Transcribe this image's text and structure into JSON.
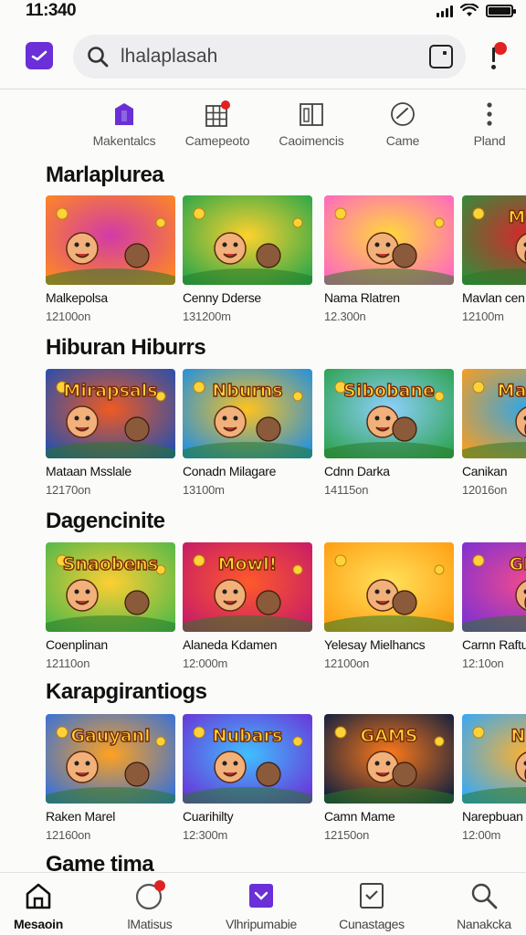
{
  "status": {
    "time": "11:340"
  },
  "header": {
    "search_value": "lhalaplasah"
  },
  "categories": [
    {
      "label": "Makentalcs",
      "icon": "house-icon"
    },
    {
      "label": "Camepeoto",
      "icon": "grid-icon"
    },
    {
      "label": "Caoimencis",
      "icon": "panel-icon"
    },
    {
      "label": "Came",
      "icon": "check-circle-icon"
    },
    {
      "label": "Pland",
      "icon": "more-vertical-icon"
    }
  ],
  "sections": [
    {
      "title": "Marlaplurea",
      "cards": [
        {
          "title": "Malkepolsa",
          "meta": "12100on",
          "art": ""
        },
        {
          "title": "Cenny Dderse",
          "meta": "131200m",
          "art": ""
        },
        {
          "title": "Nama Rlatren",
          "meta": "12.300n",
          "art": ""
        },
        {
          "title": "Mavlan cen",
          "meta": "12100m",
          "art": "Mor"
        }
      ]
    },
    {
      "title": "Hiburan Hiburrs",
      "cards": [
        {
          "title": "Mataan Msslale",
          "meta": "12170on",
          "art": "Mirapsals"
        },
        {
          "title": "Conadn Milagare",
          "meta": "13100m",
          "art": "Nburns"
        },
        {
          "title": "Cdnn Darka",
          "meta": "14115on",
          "art": "Sibobane"
        },
        {
          "title": "Canikan",
          "meta": "12016on",
          "art": "Maine"
        }
      ]
    },
    {
      "title": "Dagencinite",
      "cards": [
        {
          "title": "Coenplinan",
          "meta": "12110on",
          "art": "Snaobens"
        },
        {
          "title": "Alaneda Kdamen",
          "meta": "12:000m",
          "art": "Mowl!"
        },
        {
          "title": "Yelesay Mielhancs",
          "meta": "12100on",
          "art": ""
        },
        {
          "title": "Carnn Raftu",
          "meta": "12:10on",
          "art": "GIO"
        }
      ]
    },
    {
      "title": "Karapgirantiogs",
      "cards": [
        {
          "title": "Raken Marel",
          "meta": "12160on",
          "art": "Gauyanl"
        },
        {
          "title": "Cuarihilty",
          "meta": "12:300m",
          "art": "Nubars"
        },
        {
          "title": "Camn Mame",
          "meta": "12150on",
          "art": "GAMS"
        },
        {
          "title": "Narepbuan",
          "meta": "12:00m",
          "art": "Nia"
        }
      ]
    },
    {
      "title": "Game tima",
      "cards": []
    }
  ],
  "nav": [
    {
      "label": "Mesaoin",
      "icon": "home-icon",
      "active": true
    },
    {
      "label": "lMatisus",
      "icon": "clock-icon",
      "active": false
    },
    {
      "label": "Vlhripumabie",
      "icon": "bag-icon",
      "active": false
    },
    {
      "label": "Cunastages",
      "icon": "list-check-icon",
      "active": false
    },
    {
      "label": "Nanakcka",
      "icon": "search-icon",
      "active": false
    }
  ],
  "colors": {
    "accent": "#6a2fd6",
    "badge": "#e02222"
  }
}
